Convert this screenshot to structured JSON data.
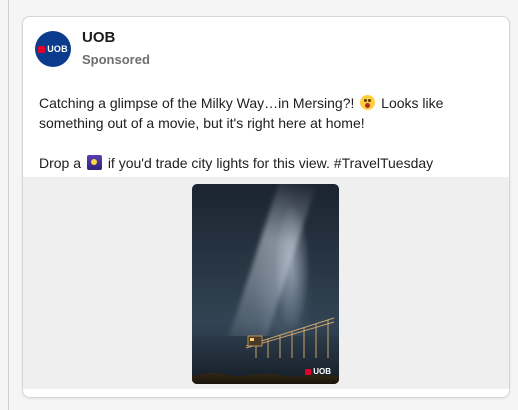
{
  "post": {
    "author": "UOB",
    "sponsored_label": "Sponsored",
    "avatar_text": "UOB",
    "text_line1_before": "Catching a glimpse of the Milky Way…in Mersing?!",
    "text_line1_after": "Looks like something out of a movie, but it's right here at home!",
    "text_line2_before": "Drop a",
    "text_line2_after": "if you'd trade city lights for this view. #TravelTuesday",
    "image_brand": "UOB"
  },
  "colors": {
    "brand_blue": "#0b3b8c",
    "brand_red": "#e4002b"
  },
  "icons": {
    "avatar": "uob-logo",
    "emoji1": "astonished-face-emoji",
    "emoji2": "night-sky-emoji"
  }
}
